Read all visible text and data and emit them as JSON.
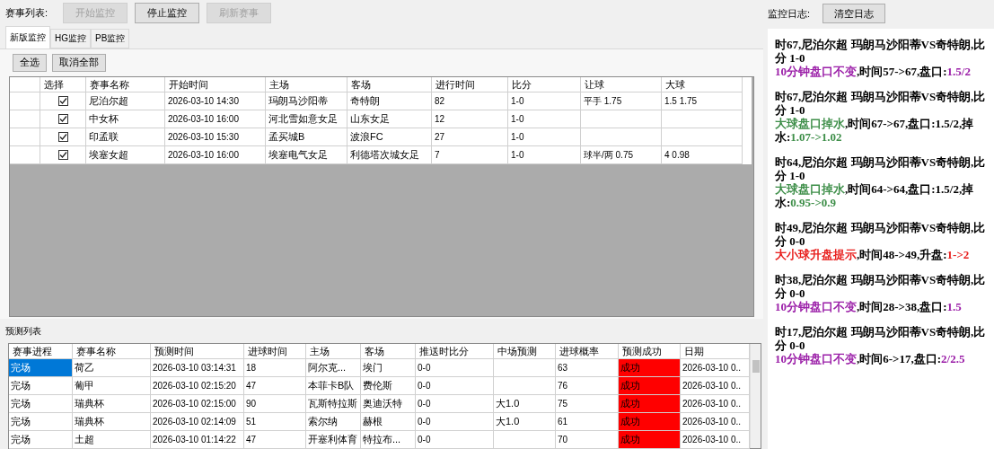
{
  "toolbar": {
    "label": "赛事列表:",
    "buttons": [
      {
        "label": "开始监控",
        "disabled": true
      },
      {
        "label": "停止监控",
        "disabled": false
      },
      {
        "label": "刷新赛事",
        "disabled": true
      }
    ]
  },
  "tabs": [
    {
      "label": "新版监控",
      "selected": true
    },
    {
      "label": "HG监控",
      "selected": false
    },
    {
      "label": "PB监控",
      "selected": false
    }
  ],
  "select_buttons": [
    "全选",
    "取消全部"
  ],
  "match_table": {
    "columns": [
      "选择",
      "赛事名称",
      "开始时间",
      "主场",
      "客场",
      "进行时间",
      "比分",
      "让球",
      "大球"
    ],
    "rows": [
      {
        "checked": true,
        "cells": [
          "",
          "尼泊尔超",
          "2026-03-10 14:30",
          "玛朗马沙阳蒂",
          "奇特朗",
          "82",
          "1-0",
          "平手 1.75",
          "1.5 1.75"
        ]
      },
      {
        "checked": true,
        "cells": [
          "",
          "中女杯",
          "2026-03-10 16:00",
          "河北雪如意女足",
          "山东女足",
          "12",
          "1-0",
          "",
          ""
        ]
      },
      {
        "checked": true,
        "cells": [
          "",
          "印孟联",
          "2026-03-10 15:30",
          "孟买城B",
          "波浪FC",
          "27",
          "1-0",
          "",
          ""
        ]
      },
      {
        "checked": true,
        "cells": [
          "",
          "埃塞女超",
          "2026-03-10 16:00",
          "埃塞电气女足",
          "利德塔次城女足",
          "7",
          "1-0",
          "球半/两 0.75",
          "4 0.98"
        ]
      }
    ]
  },
  "prediction_list": {
    "label": "预测列表",
    "columns": [
      "赛事进程",
      "赛事名称",
      "预测时间",
      "进球时间",
      "主场",
      "客场",
      "推送时比分",
      "中场预测",
      "进球概率",
      "预测成功",
      "日期"
    ],
    "rows": [
      {
        "selected": true,
        "color": "#ff0000",
        "cells": [
          "完场",
          "荷乙",
          "2026-03-10 03:14:31",
          "18",
          "阿尔克...",
          "埃门",
          "0-0",
          "",
          "63",
          "成功",
          "2026-03-10 0.."
        ]
      },
      {
        "selected": false,
        "color": "#ff0000",
        "cells": [
          "完场",
          "葡甲",
          "2026-03-10 02:15:20",
          "47",
          "本菲卡B队",
          "费伦斯",
          "0-0",
          "",
          "76",
          "成功",
          "2026-03-10 0.."
        ]
      },
      {
        "selected": false,
        "color": "#ff0000",
        "cells": [
          "完场",
          "瑞典杯",
          "2026-03-10 02:15:00",
          "90",
          "瓦斯特拉斯",
          "奥迪沃特",
          "0-0",
          "大1.0",
          "75",
          "成功",
          "2026-03-10 0.."
        ]
      },
      {
        "selected": false,
        "color": "#ff0000",
        "cells": [
          "完场",
          "瑞典杯",
          "2026-03-10 02:14:09",
          "51",
          "索尔纳",
          "赫根",
          "0-0",
          "大1.0",
          "61",
          "成功",
          "2026-03-10 0.."
        ]
      },
      {
        "selected": false,
        "color": "#ff0000",
        "cells": [
          "完场",
          "土超",
          "2026-03-10 01:14:22",
          "47",
          "开塞利体育",
          "特拉布...",
          "0-0",
          "",
          "70",
          "成功",
          "2026-03-10 0.."
        ]
      }
    ]
  },
  "log": {
    "label": "监控日志:",
    "clear_button": "清空日志",
    "entries": [
      {
        "header": "时67,尼泊尔超  玛朗马沙阳蒂VS奇特朗,比分  1-0",
        "alert": "10分钟盘口不变",
        "detail": ",时间57->67,盘口:",
        "value": "1.5/2",
        "color": "#9b1fa8"
      },
      {
        "header": "时67,尼泊尔超  玛朗马沙阳蒂VS奇特朗,比分  1-0",
        "alert": "大球盘口掉水",
        "detail": ",时间67->67,盘口:1.5/2,掉水:",
        "value": "1.07->1.02",
        "color": "#3f8f4a"
      },
      {
        "header": "时64,尼泊尔超  玛朗马沙阳蒂VS奇特朗,比分  1-0",
        "alert": "大球盘口掉水",
        "detail": ",时间64->64,盘口:1.5/2,掉水:",
        "value": "0.95->0.9",
        "color": "#3f8f4a"
      },
      {
        "header": "时49,尼泊尔超  玛朗马沙阳蒂VS奇特朗,比分  0-0",
        "alert": "大小球升盘提示",
        "detail": ",时间48->49,升盘:",
        "value": "1->2",
        "color": "#e8201e"
      },
      {
        "header": "时38,尼泊尔超  玛朗马沙阳蒂VS奇特朗,比分  0-0",
        "alert": "10分钟盘口不变",
        "detail": ",时间28->38,盘口:",
        "value": "1.5",
        "color": "#9b1fa8"
      },
      {
        "header": "时17,尼泊尔超  玛朗马沙阳蒂VS奇特朗,比分  0-0",
        "alert": "10分钟盘口不变",
        "detail": ",时间6->17,盘口:",
        "value": "2/2.5",
        "color": "#9b1fa8"
      }
    ]
  }
}
